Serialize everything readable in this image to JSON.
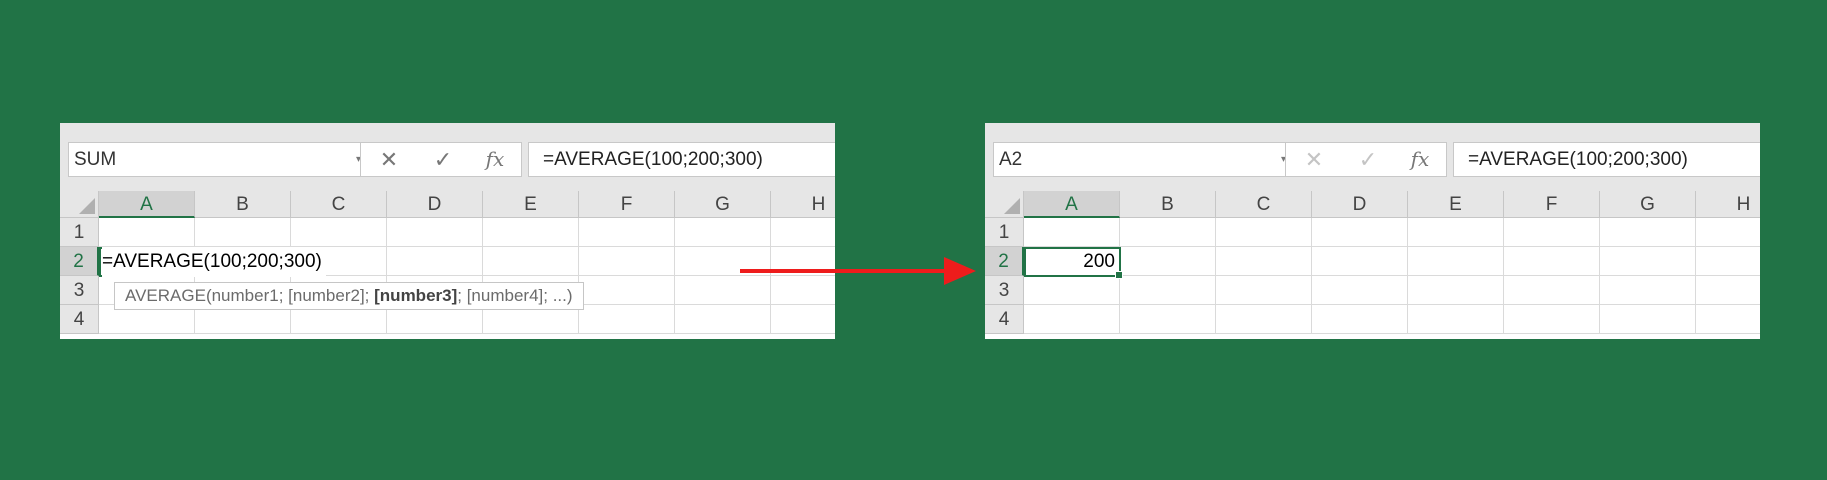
{
  "left": {
    "name_box": "SUM",
    "formula_bar": "=AVERAGE(100;200;300)",
    "columns": [
      "A",
      "B",
      "C",
      "D",
      "E",
      "F",
      "G",
      "H"
    ],
    "rows": [
      "1",
      "2",
      "3",
      "4"
    ],
    "cell_edit_text": "=AVERAGE(100;200;300)",
    "tooltip": {
      "func": "AVERAGE",
      "args_before": "(number1; [number2]; ",
      "current_arg": "[number3]",
      "args_after": "; [number4]; ...)"
    }
  },
  "right": {
    "name_box": "A2",
    "formula_bar": "=AVERAGE(100;200;300)",
    "columns": [
      "A",
      "B",
      "C",
      "D",
      "E",
      "F",
      "G",
      "H"
    ],
    "rows": [
      "1",
      "2",
      "3",
      "4"
    ],
    "cell_value": "200"
  },
  "icons": {
    "cancel": "✕",
    "enter": "✓",
    "fx": "fx",
    "dropdown": "▾",
    "vdots": "⋮"
  },
  "colors": {
    "background": "#217346",
    "accent": "#217346",
    "arrow": "#ee1c1c"
  }
}
